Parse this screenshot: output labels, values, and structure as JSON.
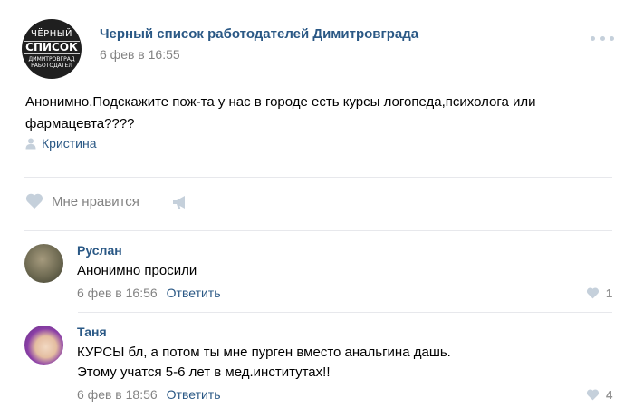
{
  "post": {
    "group_name": "Черный список работодателей Димитровграда",
    "date": "6 фев в 16:55",
    "avatar_lines": [
      "ЧЁРНЫЙ",
      "СПИСОК",
      "ДИМИТРОВГРАД",
      "РАБОТОДАТЕЛ"
    ],
    "text_lines": [
      "Анонимно.Подскажите пож-та у нас в городе есть курсы логопеда,психолога или",
      "фармацевта????"
    ],
    "signer": "Кристина",
    "like_label": "Мне нравится"
  },
  "comments": [
    {
      "author": "Руслан",
      "text_lines": [
        "Анонимно просили"
      ],
      "date": "6 фев в 16:56",
      "reply_label": "Ответить",
      "likes": "1"
    },
    {
      "author": "Таня",
      "text_lines": [
        "КУРСЫ бл, а потом ты мне пурген вместо анальгина дашь.",
        "Этому учатся 5-6 лет в мед.институтах!!"
      ],
      "date": "6 фев в 18:56",
      "reply_label": "Ответить",
      "likes": "4"
    }
  ],
  "colors": {
    "link": "#2a5885",
    "muted": "#828282",
    "divider": "#e7e8ec",
    "icon": "#c5d0db"
  },
  "icons": [
    "more-icon",
    "user-icon",
    "heart-icon",
    "megaphone-icon"
  ]
}
